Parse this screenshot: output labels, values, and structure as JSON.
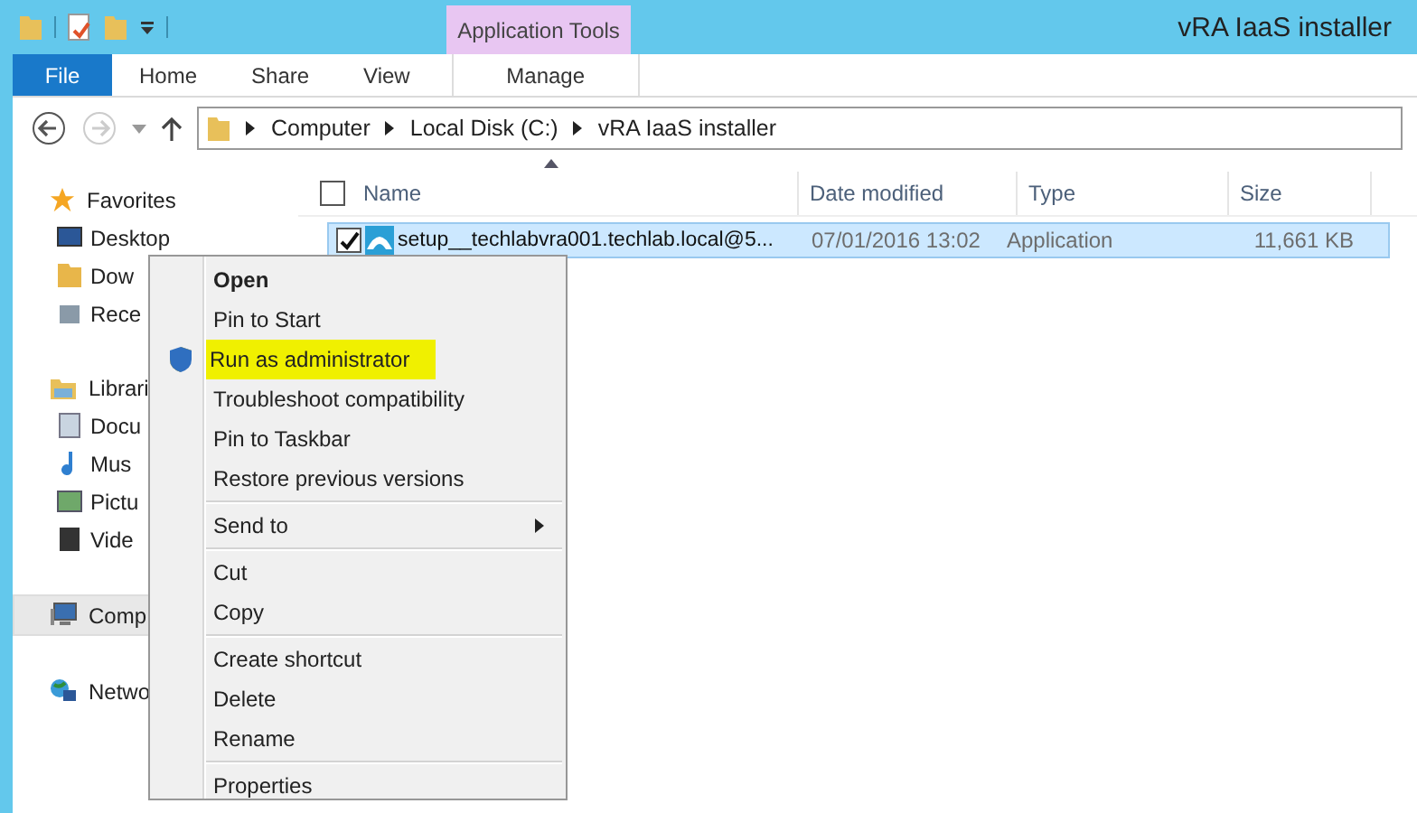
{
  "window": {
    "title": "vRA IaaS installer",
    "context_tab_group": "Application Tools"
  },
  "ribbon_tabs": [
    {
      "label": "File",
      "selected": false,
      "kind": "file"
    },
    {
      "label": "Home",
      "selected": false,
      "kind": "tab"
    },
    {
      "label": "Share",
      "selected": false,
      "kind": "tab"
    },
    {
      "label": "View",
      "selected": false,
      "kind": "tab"
    },
    {
      "label": "Manage",
      "selected": false,
      "kind": "context"
    }
  ],
  "address": {
    "crumbs": [
      "Computer",
      "Local Disk (C:)",
      "vRA IaaS installer"
    ]
  },
  "sidebar": {
    "groups": [
      {
        "label": "Favorites",
        "selected": false,
        "children": [
          {
            "label": "Desktop"
          },
          {
            "label": "Dow"
          },
          {
            "label": "Rece"
          }
        ]
      },
      {
        "label": "Librari",
        "selected": false,
        "children": [
          {
            "label": "Docu"
          },
          {
            "label": "Mus"
          },
          {
            "label": "Pictu"
          },
          {
            "label": "Vide"
          }
        ]
      },
      {
        "label": "Comp",
        "selected": true
      },
      {
        "label": "Netwo",
        "selected": false
      }
    ]
  },
  "table": {
    "all_checked": false,
    "columns": [
      "Name",
      "Date modified",
      "Type",
      "Size"
    ],
    "rows": [
      {
        "name": "setup__techlabvra001.techlab.local@5...",
        "date": "07/01/2016 13:02",
        "type": "Application",
        "size": "11,661 KB",
        "selected": true,
        "checked": true
      }
    ]
  },
  "context_menu": {
    "items": [
      {
        "kind": "item",
        "label": "Open",
        "default": true,
        "shield": false,
        "highlighted": false
      },
      {
        "kind": "item",
        "label": "Pin to Start",
        "default": false,
        "shield": false,
        "highlighted": false
      },
      {
        "kind": "item",
        "label": "Run as administrator",
        "default": false,
        "shield": true,
        "highlighted": true
      },
      {
        "kind": "item",
        "label": "Troubleshoot compatibility",
        "default": false,
        "shield": false,
        "highlighted": false
      },
      {
        "kind": "item",
        "label": "Pin to Taskbar",
        "default": false,
        "shield": false,
        "highlighted": false
      },
      {
        "kind": "item",
        "label": "Restore previous versions",
        "default": false,
        "shield": false,
        "highlighted": false
      },
      {
        "kind": "separator"
      },
      {
        "kind": "submenu",
        "label": "Send to",
        "default": false,
        "shield": false,
        "highlighted": false
      },
      {
        "kind": "separator"
      },
      {
        "kind": "item",
        "label": "Cut",
        "default": false,
        "shield": false,
        "highlighted": false
      },
      {
        "kind": "item",
        "label": "Copy",
        "default": false,
        "shield": false,
        "highlighted": false
      },
      {
        "kind": "separator"
      },
      {
        "kind": "item",
        "label": "Create shortcut",
        "default": false,
        "shield": false,
        "highlighted": false
      },
      {
        "kind": "item",
        "label": "Delete",
        "default": false,
        "shield": false,
        "highlighted": false
      },
      {
        "kind": "item",
        "label": "Rename",
        "default": false,
        "shield": false,
        "highlighted": false
      },
      {
        "kind": "separator"
      },
      {
        "kind": "item",
        "label": "Properties",
        "default": false,
        "shield": false,
        "highlighted": false
      }
    ]
  }
}
